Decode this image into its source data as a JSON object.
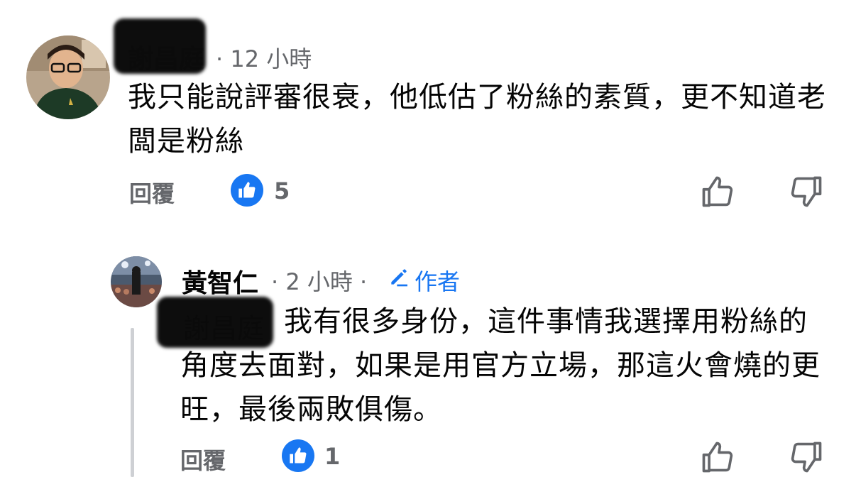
{
  "comment": {
    "author": "謝昌庭",
    "time": "· 12 小時",
    "text": "我只能說評審很衰，他低估了粉絲的素質，更不知道老闆是粉絲",
    "reply_label": "回覆",
    "like_count": "5"
  },
  "reply": {
    "author": "黃智仁",
    "time": "· 2 小時 ·",
    "author_badge": "作者",
    "mention": "謝昌庭",
    "text": "我有很多身份，這件事情我選擇用粉絲的角度去面對，如果是用官方立場，那這火會燒的更旺，最後兩敗俱傷。",
    "reply_label": "回覆",
    "like_count": "1"
  },
  "icons": {
    "like_badge": "thumbs-up-filled-icon",
    "like_action": "thumbs-up-outline-icon",
    "dislike_action": "thumbs-down-outline-icon",
    "author_badge": "pencil-icon"
  },
  "colors": {
    "accent": "#1877f2",
    "secondary_text": "#65676b",
    "primary_text": "#050505"
  }
}
